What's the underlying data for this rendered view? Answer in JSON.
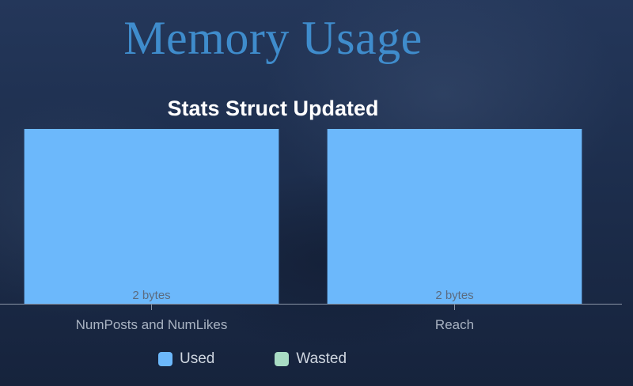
{
  "slide": {
    "title": "Memory Usage"
  },
  "colors": {
    "used": "#6cb8fb",
    "wasted": "#a8dcc4",
    "axis": "#8a95a6",
    "title": "#ffffff"
  },
  "chart_data": {
    "type": "bar",
    "stacked": true,
    "title": "Stats Struct Updated",
    "categories": [
      "NumPosts and NumLikes",
      "Reach"
    ],
    "series": [
      {
        "name": "Used",
        "values": [
          2,
          2
        ],
        "labels": [
          "2 bytes",
          "2 bytes"
        ]
      },
      {
        "name": "Wasted",
        "values": [
          0,
          0
        ]
      }
    ],
    "ylim": [
      0,
      2
    ],
    "grid": false,
    "legend": "bottom"
  }
}
